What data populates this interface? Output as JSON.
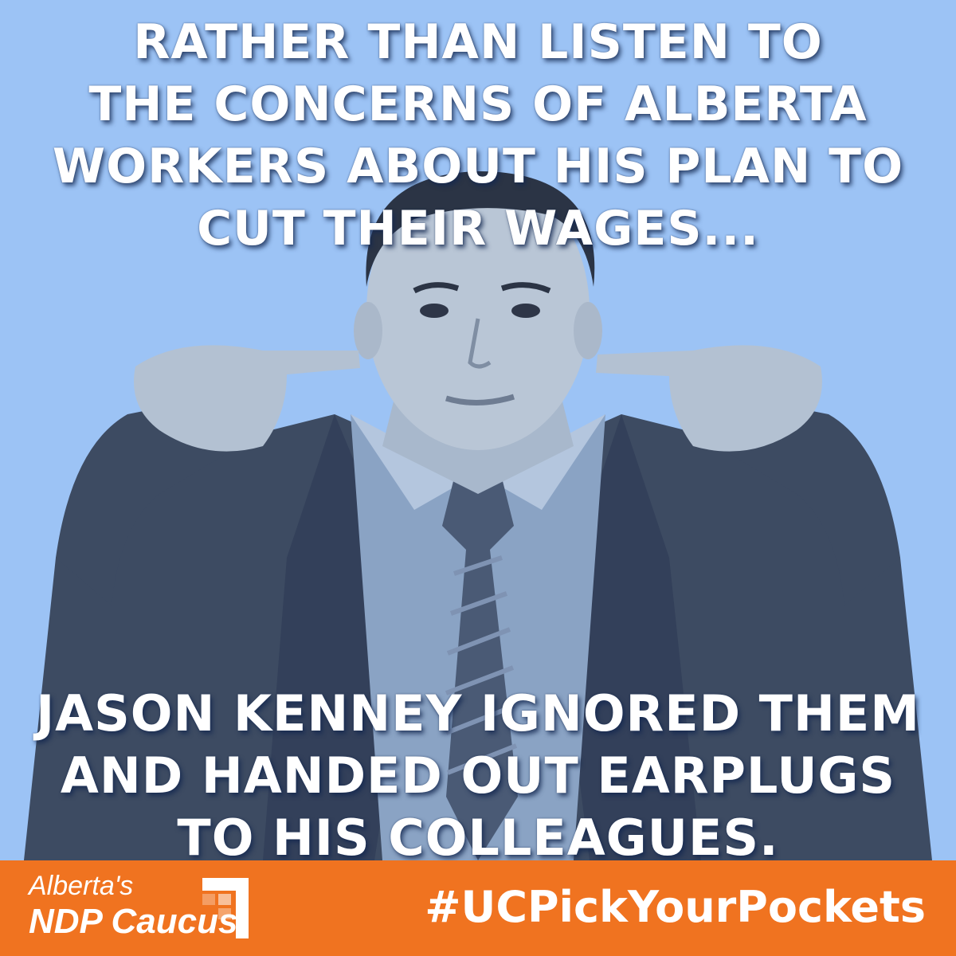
{
  "headline_top": {
    "lines": [
      "RATHER THAN LISTEN TO",
      "THE CONCERNS OF ALBERTA",
      "WORKERS ABOUT HIS PLAN TO",
      "CUT THEIR WAGES..."
    ]
  },
  "headline_bottom": {
    "lines": [
      "JASON KENNEY IGNORED THEM",
      "AND HANDED OUT EARPLUGS",
      "TO HIS COLLEAGUES."
    ]
  },
  "footer": {
    "brand_line1": "Alberta's",
    "brand_line2": "NDP Caucus",
    "hashtag": "#UCPickYourPockets"
  },
  "colors": {
    "background": "#9cc3f5",
    "footer": "#f07320",
    "text": "#ffffff"
  }
}
